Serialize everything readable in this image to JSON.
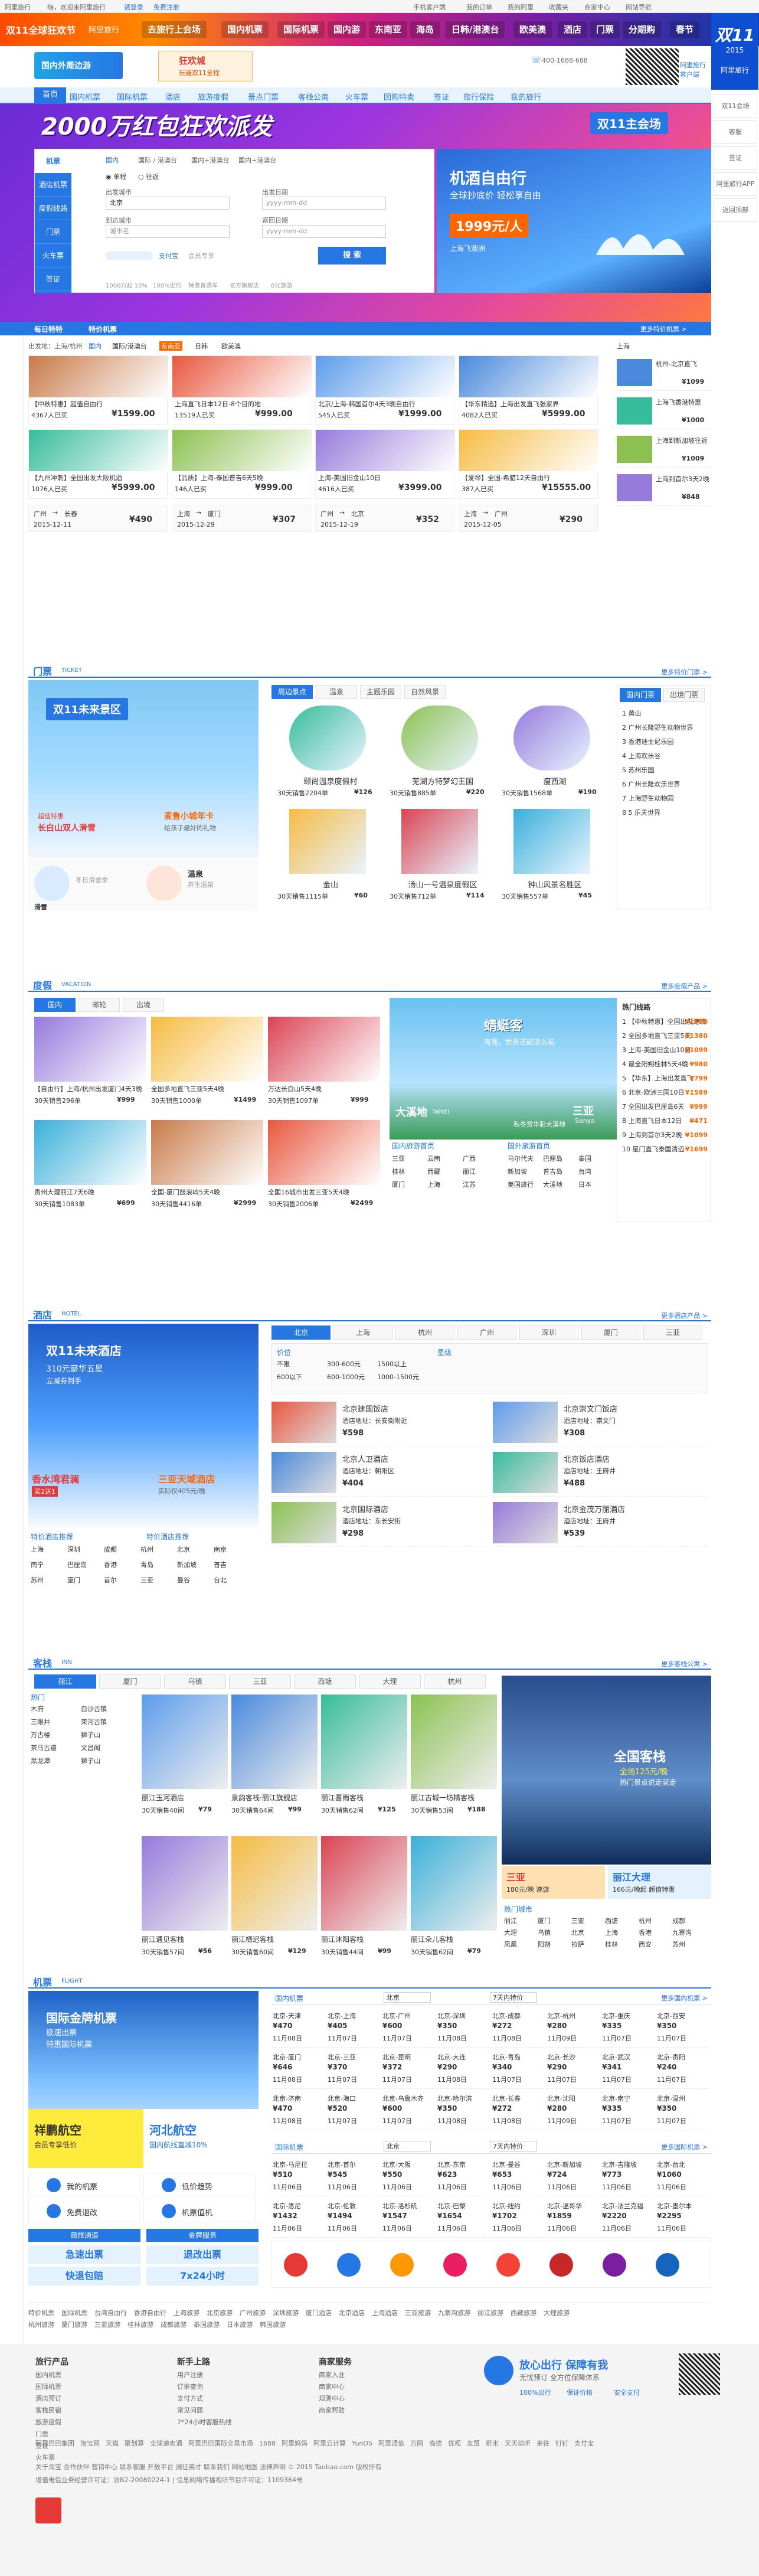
{
  "topbar": {
    "left": "阿里旅行",
    "welcome": "嗨，欢迎来阿里旅行",
    "login": "请登录",
    "register": "免费注册",
    "right_items": [
      "手机客户端",
      "我的订单",
      "我的阿里",
      "收藏夹",
      "商家中心",
      "网站导航"
    ]
  },
  "ribbon": {
    "title": "双11全球狂欢节",
    "brand": "阿里旅行",
    "segments": [
      "去旅行上会场",
      "国内机票",
      "国际机票",
      "国内游",
      "东南亚",
      "海岛",
      "日韩/港澳台",
      "欧美澳",
      "酒店",
      "门票",
      "分期购",
      "春节"
    ],
    "logo_text": "双11",
    "logo_sub": "2015"
  },
  "header": {
    "ad1": "国内外周边游",
    "ad2_title": "狂欢城",
    "ad2_sub": "玩遍双11全程",
    "service_phone": "400-1688-688",
    "qr_label": "阿里旅行客户端",
    "nav_items": [
      "首页",
      "国内机票",
      "国际机票",
      "酒店",
      "旅游度假",
      "景点门票",
      "客栈公寓",
      "火车票",
      "团购特卖",
      "签证",
      "旅行保险",
      "我的旅行"
    ],
    "nav_active": "首页"
  },
  "hero": {
    "banner_title": "2000万红包狂欢派发",
    "banner_badge": "双11主会场",
    "search_tabs": [
      "机票",
      "酒店机票",
      "度假线路",
      "门票",
      "火车票",
      "签证",
      "手机充值"
    ],
    "search_active": "机票",
    "search_sub_tabs": [
      "国内",
      "国际 / 港澳台",
      "国内+港澳台",
      "国内+港澳台"
    ],
    "trip_types": [
      "单程",
      "往返"
    ],
    "from_label": "出发城市",
    "from_value": "北京",
    "to_label": "到达城市",
    "to_placeholder": "城市名",
    "date_label": "出发日期",
    "date_placeholder": "yyyy-mm-dd",
    "return_label": "返回日期",
    "search_button": "搜 索",
    "bottom_links": [
      "1000万起 10%",
      "100%出行",
      "特惠直通车",
      "官方旗舰店",
      "0元旅游"
    ],
    "right_promo_title": "机酒自由行",
    "right_promo_sub": "全球抄底价 轻松享自由",
    "right_promo_price": "1999元/人",
    "right_promo_badge": "上海飞澳洲",
    "alipay_label": "支付宝",
    "alipay_sub": "会员专享",
    "subnav_items": [
      "每日特特",
      "特价机票"
    ],
    "subnav_right": "更多特价机票 >"
  },
  "flight_deals": {
    "filter_label": "出发地：上海/杭州",
    "filters": [
      "国内",
      "国际/港澳台",
      "东南亚",
      "日韩",
      "欧美澳",
      "签证"
    ],
    "right_city": "上海",
    "cards": [
      {
        "title": "【中秋特惠】超值自由行",
        "sold": "4367人已买",
        "price": "¥1599.00"
      },
      {
        "title": "上海直飞日本12日-8个目的地",
        "sold": "13519人已买",
        "price": "¥999.00"
      },
      {
        "title": "北京/上海-韩国首尔4天3晚自由行",
        "sold": "545人已买",
        "price": "¥1999.00"
      },
      {
        "title": "【华东精选】上海出发直飞张家界",
        "sold": "4082人已买",
        "price": "¥5999.00"
      },
      {
        "title": "【九州冲刺】全国出发大阪机酒",
        "sold": "1076人已买",
        "price": "¥5999.00"
      },
      {
        "title": "【品质】上海-泰国普吉6天5晚",
        "sold": "146人已买",
        "price": "¥999.00"
      },
      {
        "title": "上海-美国旧金山10日",
        "sold": "4616人已买",
        "price": "¥3999.00"
      },
      {
        "title": "【爱琴】全国-希腊12天自由行",
        "sold": "387人已买",
        "price": "¥15555.00"
      }
    ],
    "routes": [
      {
        "from": "广州",
        "to": "长春",
        "date": "2015-12-11",
        "price": "¥490"
      },
      {
        "from": "上海",
        "to": "厦门",
        "date": "2015-12-29",
        "price": "¥307"
      },
      {
        "from": "广州",
        "to": "北京",
        "date": "2015-12-19",
        "price": "¥352"
      },
      {
        "from": "上海",
        "to": "广州",
        "date": "2015-12-05",
        "price": "¥290"
      }
    ],
    "side_list": [
      {
        "name": "杭州-北京直飞",
        "price": "¥1099"
      },
      {
        "name": "上海飞香港特惠",
        "price": "¥1000"
      },
      {
        "name": "上海到新加坡往返",
        "price": "¥1009"
      },
      {
        "name": "上海到首尔3天2晚",
        "price": "¥848"
      }
    ]
  },
  "tickets": {
    "title": "门票",
    "en": "TICKET",
    "more": "更多特价门票 >",
    "banner_title": "双11未来景区",
    "banner_sub": "超值特惠",
    "banner_line": "长白山双人滑雪",
    "banner_sub2": "麦鲁小城年卡",
    "banner_sub3": "给孩子最好的礼物",
    "icons": [
      {
        "name": "滑雪",
        "sub": "冬日滑雪季"
      },
      {
        "name": "温泉",
        "sub": "养生温泉"
      }
    ],
    "tabs": [
      "周边景点",
      "温泉",
      "主题乐园",
      "自然风景"
    ],
    "spots": [
      {
        "name": "颐尚温泉度假村",
        "sold": "30天销售2204单",
        "price": "¥126"
      },
      {
        "name": "芜湖方特梦幻王国",
        "sold": "30天销售885单",
        "price": "¥220"
      },
      {
        "name": "瘦西湖",
        "sold": "30天销售1568单",
        "price": "¥190"
      },
      {
        "name": "金山",
        "sold": "30天销售1115单",
        "price": "¥60"
      },
      {
        "name": "汤山一号温泉度假区",
        "sold": "30天销售712单",
        "price": "¥114"
      },
      {
        "name": "钟山风景名胜区",
        "sold": "30天销售557单",
        "price": "¥45"
      }
    ],
    "side_tabs": [
      "国内门票",
      "出境门票"
    ],
    "side_list": [
      "黄山",
      "广州长隆野生动物世界",
      "香港迪士尼乐园",
      "上海欢乐谷",
      "苏州乐园",
      "广州长隆欢乐世界",
      "上海野生动物园",
      "5 乐天世界"
    ]
  },
  "vacation": {
    "title": "度假",
    "en": "VACATION",
    "more": "更多度假产品 >",
    "tabs": [
      "国内",
      "邮轮",
      "出境"
    ],
    "products": [
      {
        "title": "【自由行】上海/杭州出发厦门4天3晚",
        "sold": "30天销售296单",
        "price": "¥999"
      },
      {
        "title": "全国多地直飞三亚5天4晚",
        "sold": "30天销售1000单",
        "price": "¥1499"
      },
      {
        "title": "万达长白山5天4晚",
        "sold": "30天销售1097单",
        "price": "¥999"
      },
      {
        "title": "贵州大理丽江7天6晚",
        "sold": "30天销售1083单",
        "price": "¥699"
      },
      {
        "title": "全国-厦门鼓浪屿5天4晚",
        "sold": "30天销售4416单",
        "price": "¥2999"
      },
      {
        "title": "全国16城市出发三亚5天4晚",
        "sold": "30天销售2006单",
        "price": "¥2499"
      }
    ],
    "banner_title": "蜻蜓客",
    "banner_sub": "有我，世界还能这么玩",
    "banner_place1": "大溪地",
    "banner_place1_en": "Tahiti",
    "banner_place2": "三亚",
    "banner_place2_en": "Sanya",
    "banner_note": "秋冬赏华彩大溪地",
    "dom_label": "国内旅游首页",
    "abroad_label": "国外旅游首页",
    "dom_cities": [
      "三亚",
      "云南",
      "广西",
      "桂林",
      "西藏",
      "丽江",
      "厦门",
      "上海",
      "江苏"
    ],
    "abroad_cities": [
      "马尔代夫",
      "巴厘岛",
      "泰国",
      "新加坡",
      "普吉岛",
      "台湾",
      "美国旅行",
      "大溪地",
      "日本"
    ],
    "side_title": "热门线路",
    "side_list": [
      {
        "name": "【中秋特惠】全国出发港澳",
        "price": "¥1880"
      },
      {
        "name": "全国多地直飞三亚5天",
        "price": "¥1380"
      },
      {
        "name": "上海-美国旧金山10日",
        "price": "¥1099"
      },
      {
        "name": "最全阳朔桂林5天4晚",
        "price": "¥980"
      },
      {
        "name": "【华东】上海出发直飞",
        "price": "¥799"
      },
      {
        "name": "北京-欧洲三国10日",
        "price": "¥1589"
      },
      {
        "name": "全国出发巴厘岛6天",
        "price": "¥999"
      },
      {
        "name": "上海直飞日本12日",
        "price": "¥471"
      },
      {
        "name": "上海到首尔3天2晚",
        "price": "¥1099"
      },
      {
        "name": "厦门直飞泰国清迈",
        "price": "¥1699"
      }
    ]
  },
  "hotels": {
    "title": "酒店",
    "en": "HOTEL",
    "more": "更多酒店产品 >",
    "banner_title": "双11未来酒店",
    "banner_sub": "310元豪华五星",
    "banner_sub2": "立减券到手",
    "b1": "香水湾君澜",
    "b1_sub": "买2送1",
    "b2": "三亚天域酒店",
    "b2_sub": "实际仅405元/晚",
    "city_tabs": [
      "北京",
      "上海",
      "杭州",
      "广州",
      "深圳",
      "厦门",
      "三亚"
    ],
    "price_label": "价位",
    "star_label": "星级",
    "price_rows": [
      [
        "不限",
        "300-600元",
        "1500以上"
      ],
      [
        "600以下",
        "600-1000元",
        "1000-1500元"
      ]
    ],
    "list": [
      {
        "name": "北京建国饭店",
        "addr": "酒店地址：长安街附近",
        "price": "¥598"
      },
      {
        "name": "北京崇文门饭店",
        "addr": "酒店地址：崇文门",
        "price": "¥308"
      },
      {
        "name": "北京人卫酒店",
        "addr": "酒店地址：朝阳区",
        "price": "¥404"
      },
      {
        "name": "北京饭店酒店",
        "addr": "酒店地址：王府井",
        "price": "¥488"
      },
      {
        "name": "北京国际酒店",
        "addr": "酒店地址：东长安街",
        "price": "¥298"
      },
      {
        "name": "北京金茂万丽酒店",
        "addr": "酒店地址：王府井",
        "price": "¥539"
      }
    ],
    "side_label1": "特价酒店推荐",
    "side_label2": "特价酒店推荐",
    "side_cities": [
      "上海",
      "深圳",
      "成都",
      "杭州",
      "北京",
      "南京",
      "南宁",
      "巴厘岛",
      "香港",
      "青岛",
      "新加坡",
      "普吉",
      "苏州",
      "厦门",
      "首尔",
      "三亚",
      "曼谷",
      "台北"
    ]
  },
  "inns": {
    "title": "客栈",
    "en": "INN",
    "more": "更多客栈公寓 >",
    "city_tabs": [
      "丽江",
      "厦门",
      "乌镇",
      "三亚",
      "西塘",
      "大理",
      "杭州"
    ],
    "side_title": "热门",
    "side_items": [
      "木府",
      "白沙古镇",
      "三眼井",
      "束河古镇",
      "万古楼",
      "狮子山",
      "茶马古道",
      "文昌阁",
      "黑龙潭",
      "狮子山"
    ],
    "list": [
      {
        "name": "丽江玉河酒店",
        "sold": "30天销售40间",
        "price": "¥79"
      },
      {
        "name": "泉韵客栈·丽江旗舰店",
        "sold": "30天销售64间",
        "price": "¥99"
      },
      {
        "name": "丽江喜雨客栈",
        "sold": "30天销售62间",
        "price": "¥125"
      },
      {
        "name": "丽江古城一坊精客栈",
        "sold": "30天销售53间",
        "price": "¥188"
      },
      {
        "name": "丽江遇见客栈",
        "sold": "30天销售57间",
        "price": "¥56"
      },
      {
        "name": "丽江栖迟客栈",
        "sold": "30天销售60间",
        "price": "¥129"
      },
      {
        "name": "丽江沐阳客栈",
        "sold": "30天销售44间",
        "price": "¥99"
      },
      {
        "name": "丽江朵儿客栈",
        "sold": "30天销售62间",
        "price": "¥79"
      }
    ],
    "banner_title": "全国客栈",
    "banner_sub": "全场125元/晚",
    "banner_sub2": "热门景点说走就走",
    "b1": "三亚",
    "b1_sub": "180元/晚 速游",
    "b2": "丽江大理",
    "b2_sub": "166元/晚起 超值特惠",
    "city_label": "热门城市",
    "cities": [
      "丽江",
      "厦门",
      "三亚",
      "西塘",
      "杭州",
      "成都",
      "大理",
      "乌镇",
      "北京",
      "上海",
      "香港",
      "九寨沟",
      "凤凰",
      "阳朔",
      "拉萨",
      "桂林",
      "西安",
      "苏州"
    ]
  },
  "flights": {
    "title": "机票",
    "en": "FLIGHT",
    "more_dom": "更多国内机票 >",
    "more_intl": "更多国际机票 >",
    "banner_title": "国际金牌机票",
    "banner_sub": "极速出票",
    "banner_sub2": "特惠国际机票",
    "b_left": "祥鹏航空",
    "b_left_sub": "会员专享低价",
    "b_right": "河北航空",
    "b_right_sub": "国内航线直减10%",
    "icons": [
      {
        "label": "我的机票"
      },
      {
        "label": "低价趋势"
      },
      {
        "label": "免费退改"
      },
      {
        "label": "机票值机"
      }
    ],
    "footer_titles": [
      "商旅通道",
      "金牌服务"
    ],
    "footer_btn1": "急速出票",
    "footer_btn2": "快退包赔",
    "footer_btn3": "退改出票",
    "footer_btn4": "7x24小时",
    "dom_label": "国内机票",
    "intl_label": "国际机票",
    "from_city": "北京",
    "month_filter": "7天内特价",
    "dom_rows": [
      [
        {
          "route": "北京-天津",
          "price": "¥470",
          "date": "11月08日"
        },
        {
          "route": "北京-上海",
          "price": "¥405",
          "date": "11月07日"
        },
        {
          "route": "北京-广州",
          "price": "¥600",
          "date": "11月07日"
        },
        {
          "route": "北京-深圳",
          "price": "¥350",
          "date": "11月08日"
        },
        {
          "route": "北京-成都",
          "price": "¥272",
          "date": "11月08日"
        },
        {
          "route": "北京-杭州",
          "price": "¥280",
          "date": "11月09日"
        },
        {
          "route": "北京-重庆",
          "price": "¥335",
          "date": "11月07日"
        },
        {
          "route": "北京-西安",
          "price": "¥350",
          "date": "11月07日"
        }
      ],
      [
        {
          "route": "北京-厦门",
          "price": "¥646",
          "date": "11月08日"
        },
        {
          "route": "北京-三亚",
          "price": "¥370",
          "date": "11月07日"
        },
        {
          "route": "北京-昆明",
          "price": "¥372",
          "date": "11月07日"
        },
        {
          "route": "北京-大连",
          "price": "¥290",
          "date": "11月08日"
        },
        {
          "route": "北京-青岛",
          "price": "¥340",
          "date": "11月07日"
        },
        {
          "route": "北京-长沙",
          "price": "¥290",
          "date": "11月07日"
        },
        {
          "route": "北京-武汉",
          "price": "¥341",
          "date": "11月07日"
        },
        {
          "route": "北京-贵阳",
          "price": "¥240",
          "date": "11月07日"
        }
      ],
      [
        {
          "route": "北京-济南",
          "price": "¥470",
          "date": "11月08日"
        },
        {
          "route": "北京-海口",
          "price": "¥520",
          "date": "11月07日"
        },
        {
          "route": "北京-乌鲁木齐",
          "price": "¥600",
          "date": "11月07日"
        },
        {
          "route": "北京-哈尔滨",
          "price": "¥350",
          "date": "11月08日"
        },
        {
          "route": "北京-长春",
          "price": "¥272",
          "date": "11月08日"
        },
        {
          "route": "北京-沈阳",
          "price": "¥280",
          "date": "11月09日"
        },
        {
          "route": "北京-南宁",
          "price": "¥335",
          "date": "11月07日"
        },
        {
          "route": "北京-温州",
          "price": "¥350",
          "date": "11月07日"
        }
      ]
    ],
    "intl_rows": [
      [
        {
          "route": "北京-马尼拉",
          "price": "¥510",
          "date": "11月06日"
        },
        {
          "route": "北京-首尔",
          "price": "¥545",
          "date": "11月06日"
        },
        {
          "route": "北京-大阪",
          "price": "¥550",
          "date": "11月06日"
        },
        {
          "route": "北京-东京",
          "price": "¥623",
          "date": "11月06日"
        },
        {
          "route": "北京-曼谷",
          "price": "¥653",
          "date": "11月06日"
        },
        {
          "route": "北京-新加坡",
          "price": "¥724",
          "date": "11月06日"
        },
        {
          "route": "北京-吉隆坡",
          "price": "¥773",
          "date": "11月06日"
        },
        {
          "route": "北京-台北",
          "price": "¥1060",
          "date": "11月06日"
        }
      ],
      [
        {
          "route": "北京-悉尼",
          "price": "¥1432",
          "date": "11月06日"
        },
        {
          "route": "北京-伦敦",
          "price": "¥1494",
          "date": "11月06日"
        },
        {
          "route": "北京-洛杉矶",
          "price": "¥1547",
          "date": "11月06日"
        },
        {
          "route": "北京-巴黎",
          "price": "¥1654",
          "date": "11月06日"
        },
        {
          "route": "北京-纽约",
          "price": "¥1702",
          "date": "11月06日"
        },
        {
          "route": "北京-温哥华",
          "price": "¥1859",
          "date": "11月06日"
        },
        {
          "route": "北京-法兰克福",
          "price": "¥2220",
          "date": "11月06日"
        },
        {
          "route": "北京-墨尔本",
          "price": "¥2295",
          "date": "11月06日"
        }
      ]
    ]
  },
  "footer_links": {
    "row1": [
      "特价机票",
      "国际机票",
      "台湾自由行",
      "香港自由行",
      "上海旅游",
      "北京旅游",
      "广州旅游",
      "深圳旅游",
      "厦门酒店",
      "北京酒店",
      "上海酒店",
      "三亚旅游",
      "九寨沟旅游",
      "丽江旅游",
      "西藏旅游",
      "大理旅游"
    ],
    "row2": [
      "杭州旅游",
      "厦门旅游",
      "三亚旅游",
      "桂林旅游",
      "成都旅游",
      "泰国旅游",
      "日本旅游",
      "韩国旅游"
    ]
  },
  "footer": {
    "col1_title": "旅行产品",
    "col1": [
      "国内机票",
      "国际机票",
      "酒店预订",
      "客栈民宿",
      "旅游度假",
      "门票",
      "签证",
      "火车票"
    ],
    "col2_title": "新手上路",
    "col2": [
      "用户注册",
      "订单查询",
      "支付方式",
      "常见问题",
      "7*24小时客服热线"
    ],
    "col3_title": "商家服务",
    "col3": [
      "商家入驻",
      "商家中心",
      "规则中心",
      "商家帮助"
    ],
    "slogan_title": "放心出行 保障有我",
    "slogan_sub": "无忧预订 全方位保障体系",
    "badges": [
      "100%出行",
      "保证价格",
      "安全支付"
    ],
    "copyright_links": [
      "阿里巴巴集团",
      "淘宝网",
      "天猫",
      "聚划算",
      "全球速卖通",
      "阿里巴巴国际交易市场",
      "1688",
      "阿里妈妈",
      "阿里云计算",
      "YunOS",
      "阿里通信",
      "万网",
      "高德",
      "优视",
      "友盟",
      "虾米",
      "天天动听",
      "来往",
      "钉钉",
      "支付宝"
    ],
    "legal": "关于淘宝 合作伙伴 营销中心 联系客服 开放平台 诚征英才 联系我们 网站地图 法律声明 © 2015 Taobao.com 版权所有",
    "icp": "增值电信业务经营许可证：浙B2-20080224-1 | 信息网络传播视听节目许可证：1109364号"
  },
  "right_sidebar": [
    "双11会场",
    "客服",
    "签证",
    "阿里旅行APP",
    "返回顶部"
  ],
  "colors": {
    "brand": "#2577e3",
    "accent": "#ff6600",
    "promo": "#ff4a00"
  }
}
